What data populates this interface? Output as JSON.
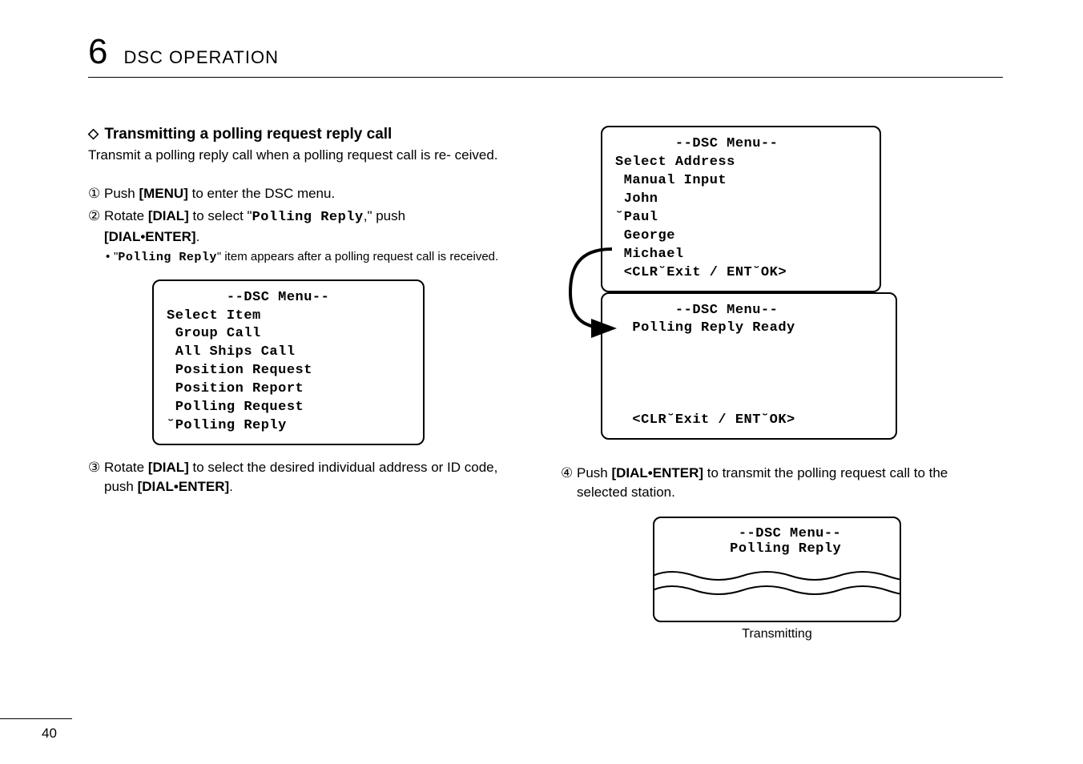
{
  "chapter": {
    "number": "6",
    "title": "DSC OPERATION"
  },
  "section": {
    "diamond": "◇",
    "title": "Transmitting a polling request reply call"
  },
  "intro": "Transmit a polling reply call when a polling request call is re-\nceived.",
  "steps": {
    "s1": {
      "num": "①",
      "pre": "Push ",
      "bold": "[MENU]",
      "post": " to enter the DSC menu."
    },
    "s2": {
      "num": "②",
      "pre": "Rotate ",
      "bold1": "[DIAL]",
      "mid": " to select \"",
      "lcd": "Polling Reply",
      "post": ",\" push ",
      "bold2": "[DIAL•ENTER]",
      "end": "."
    },
    "s2note": {
      "pre": "\"",
      "lcd": "Polling Reply",
      "post": "\" item appears after a polling request call is received."
    },
    "s3": {
      "num": "③",
      "pre": "Rotate ",
      "bold1": "[DIAL]",
      "mid": " to select the desired individual address or ID code, push ",
      "bold2": "[DIAL•ENTER]",
      "end": "."
    },
    "s4": {
      "num": "④",
      "pre": "Push ",
      "bold": "[DIAL•ENTER]",
      "post": " to transmit the polling request call to the selected station."
    }
  },
  "lcd1": "       --DSC Menu--\nSelect Item\n Group Call\n All Ships Call\n Position Request\n Position Report\n Polling Request\n˘Polling Reply",
  "lcd2top": "       --DSC Menu--\nSelect Address\n Manual Input\n John\n˘Paul\n George\n Michael\n <CLR˘Exit / ENT˘OK>",
  "lcd2bottom": "       --DSC Menu--\n  Polling Reply Ready\n\n\n\n\n  <CLR˘Exit / ENT˘OK>",
  "lcd3": "   --DSC Menu--\n  Polling Reply",
  "transmitting": "Transmitting",
  "pageNumber": "40"
}
